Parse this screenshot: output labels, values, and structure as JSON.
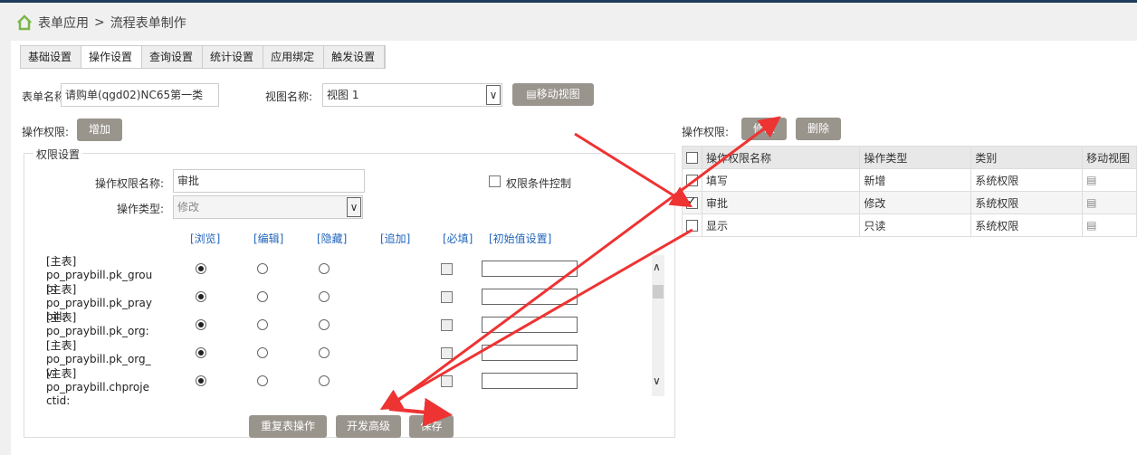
{
  "breadcrumb": {
    "home": "表单应用",
    "sep": ">",
    "current": "流程表单制作"
  },
  "tabs": [
    "基础设置",
    "操作设置",
    "查询设置",
    "统计设置",
    "应用绑定",
    "触发设置"
  ],
  "form": {
    "name_label": "表单名称:",
    "name_value": "请购单(qgd02)NC65第一类",
    "view_label": "视图名称:",
    "view_value": "视图 1",
    "move_view": "移动视图"
  },
  "left": {
    "perm_label": "操作权限:",
    "add": "增加",
    "fieldset": "权限设置",
    "perm_name_label": "操作权限名称:",
    "perm_name_value": "审批",
    "op_type_label": "操作类型:",
    "op_type_value": "修改",
    "cond_ctrl": "权限条件控制",
    "cols": [
      "[浏览]",
      "[编辑]",
      "[隐藏]",
      "[追加]",
      "[必填]",
      "[初始值设置]"
    ],
    "fields": [
      {
        "l1": "[主表] po_praybill.pk_grou",
        "l2": "p:",
        "sel": 0
      },
      {
        "l1": "[主表] po_praybill.pk_pray",
        "l2": "bill:",
        "sel": 0
      },
      {
        "l1": "[主表] po_praybill.pk_org:",
        "l2": "",
        "sel": 0
      },
      {
        "l1": "[主表] po_praybill.pk_org_",
        "l2": "v:",
        "sel": 0
      },
      {
        "l1": "[主表] po_praybill.chproje",
        "l2": "ctid:",
        "sel": 0
      }
    ],
    "buttons": {
      "repeat": "重复表操作",
      "advanced": "开发高级",
      "save": "保存"
    }
  },
  "right": {
    "perm_label": "操作权限:",
    "modify": "修改",
    "delete": "删除",
    "headers": [
      "操作权限名称",
      "操作类型",
      "类别",
      "移动视图"
    ],
    "rows": [
      {
        "name": "填写",
        "type": "新增",
        "cat": "系统权限",
        "checked": false
      },
      {
        "name": "审批",
        "type": "修改",
        "cat": "系统权限",
        "checked": true
      },
      {
        "name": "显示",
        "type": "只读",
        "cat": "系统权限",
        "checked": false
      }
    ]
  },
  "colors": {
    "button": "#99948c",
    "link": "#2266bb",
    "arrow": "#ee3333"
  }
}
